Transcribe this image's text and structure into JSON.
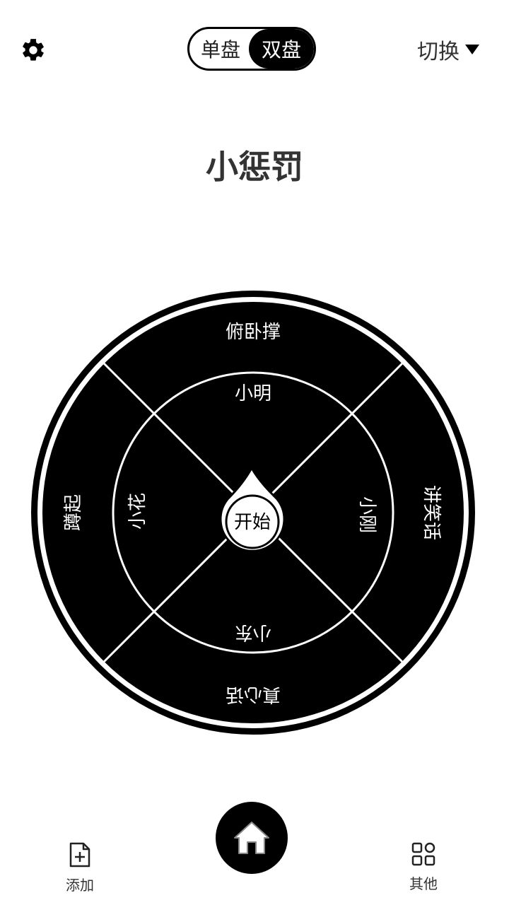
{
  "header": {
    "settings_icon": "gear-icon",
    "mode_single": "单盘",
    "mode_double": "双盘",
    "mode_selected": "双盘",
    "switch_label": "切换"
  },
  "title": "小惩罚",
  "wheel": {
    "outer_ring": [
      "俯卧撑",
      "讲笑话",
      "真心话",
      "蹲起"
    ],
    "inner_ring": [
      "小明",
      "小刚",
      "小东",
      "小花"
    ],
    "start_label": "开始"
  },
  "bottom_nav": {
    "add_label": "添加",
    "add_icon": "add-file-icon",
    "home_icon": "home-icon",
    "other_label": "其他",
    "other_icon": "grid-icon"
  }
}
